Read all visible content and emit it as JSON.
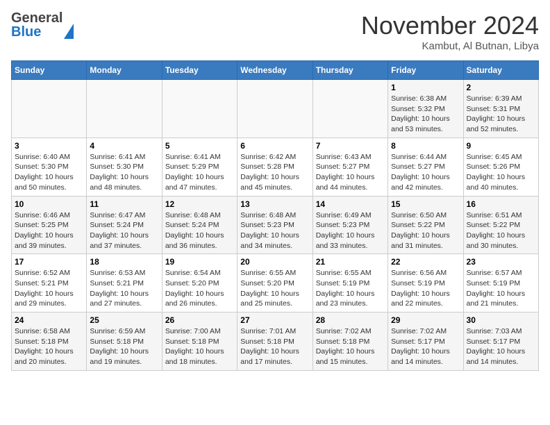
{
  "header": {
    "logo_general": "General",
    "logo_blue": "Blue",
    "month_title": "November 2024",
    "subtitle": "Kambut, Al Butnan, Libya"
  },
  "weekdays": [
    "Sunday",
    "Monday",
    "Tuesday",
    "Wednesday",
    "Thursday",
    "Friday",
    "Saturday"
  ],
  "weeks": [
    [
      {
        "day": "",
        "info": ""
      },
      {
        "day": "",
        "info": ""
      },
      {
        "day": "",
        "info": ""
      },
      {
        "day": "",
        "info": ""
      },
      {
        "day": "",
        "info": ""
      },
      {
        "day": "1",
        "info": "Sunrise: 6:38 AM\nSunset: 5:32 PM\nDaylight: 10 hours\nand 53 minutes."
      },
      {
        "day": "2",
        "info": "Sunrise: 6:39 AM\nSunset: 5:31 PM\nDaylight: 10 hours\nand 52 minutes."
      }
    ],
    [
      {
        "day": "3",
        "info": "Sunrise: 6:40 AM\nSunset: 5:30 PM\nDaylight: 10 hours\nand 50 minutes."
      },
      {
        "day": "4",
        "info": "Sunrise: 6:41 AM\nSunset: 5:30 PM\nDaylight: 10 hours\nand 48 minutes."
      },
      {
        "day": "5",
        "info": "Sunrise: 6:41 AM\nSunset: 5:29 PM\nDaylight: 10 hours\nand 47 minutes."
      },
      {
        "day": "6",
        "info": "Sunrise: 6:42 AM\nSunset: 5:28 PM\nDaylight: 10 hours\nand 45 minutes."
      },
      {
        "day": "7",
        "info": "Sunrise: 6:43 AM\nSunset: 5:27 PM\nDaylight: 10 hours\nand 44 minutes."
      },
      {
        "day": "8",
        "info": "Sunrise: 6:44 AM\nSunset: 5:27 PM\nDaylight: 10 hours\nand 42 minutes."
      },
      {
        "day": "9",
        "info": "Sunrise: 6:45 AM\nSunset: 5:26 PM\nDaylight: 10 hours\nand 40 minutes."
      }
    ],
    [
      {
        "day": "10",
        "info": "Sunrise: 6:46 AM\nSunset: 5:25 PM\nDaylight: 10 hours\nand 39 minutes."
      },
      {
        "day": "11",
        "info": "Sunrise: 6:47 AM\nSunset: 5:24 PM\nDaylight: 10 hours\nand 37 minutes."
      },
      {
        "day": "12",
        "info": "Sunrise: 6:48 AM\nSunset: 5:24 PM\nDaylight: 10 hours\nand 36 minutes."
      },
      {
        "day": "13",
        "info": "Sunrise: 6:48 AM\nSunset: 5:23 PM\nDaylight: 10 hours\nand 34 minutes."
      },
      {
        "day": "14",
        "info": "Sunrise: 6:49 AM\nSunset: 5:23 PM\nDaylight: 10 hours\nand 33 minutes."
      },
      {
        "day": "15",
        "info": "Sunrise: 6:50 AM\nSunset: 5:22 PM\nDaylight: 10 hours\nand 31 minutes."
      },
      {
        "day": "16",
        "info": "Sunrise: 6:51 AM\nSunset: 5:22 PM\nDaylight: 10 hours\nand 30 minutes."
      }
    ],
    [
      {
        "day": "17",
        "info": "Sunrise: 6:52 AM\nSunset: 5:21 PM\nDaylight: 10 hours\nand 29 minutes."
      },
      {
        "day": "18",
        "info": "Sunrise: 6:53 AM\nSunset: 5:21 PM\nDaylight: 10 hours\nand 27 minutes."
      },
      {
        "day": "19",
        "info": "Sunrise: 6:54 AM\nSunset: 5:20 PM\nDaylight: 10 hours\nand 26 minutes."
      },
      {
        "day": "20",
        "info": "Sunrise: 6:55 AM\nSunset: 5:20 PM\nDaylight: 10 hours\nand 25 minutes."
      },
      {
        "day": "21",
        "info": "Sunrise: 6:55 AM\nSunset: 5:19 PM\nDaylight: 10 hours\nand 23 minutes."
      },
      {
        "day": "22",
        "info": "Sunrise: 6:56 AM\nSunset: 5:19 PM\nDaylight: 10 hours\nand 22 minutes."
      },
      {
        "day": "23",
        "info": "Sunrise: 6:57 AM\nSunset: 5:19 PM\nDaylight: 10 hours\nand 21 minutes."
      }
    ],
    [
      {
        "day": "24",
        "info": "Sunrise: 6:58 AM\nSunset: 5:18 PM\nDaylight: 10 hours\nand 20 minutes."
      },
      {
        "day": "25",
        "info": "Sunrise: 6:59 AM\nSunset: 5:18 PM\nDaylight: 10 hours\nand 19 minutes."
      },
      {
        "day": "26",
        "info": "Sunrise: 7:00 AM\nSunset: 5:18 PM\nDaylight: 10 hours\nand 18 minutes."
      },
      {
        "day": "27",
        "info": "Sunrise: 7:01 AM\nSunset: 5:18 PM\nDaylight: 10 hours\nand 17 minutes."
      },
      {
        "day": "28",
        "info": "Sunrise: 7:02 AM\nSunset: 5:18 PM\nDaylight: 10 hours\nand 15 minutes."
      },
      {
        "day": "29",
        "info": "Sunrise: 7:02 AM\nSunset: 5:17 PM\nDaylight: 10 hours\nand 14 minutes."
      },
      {
        "day": "30",
        "info": "Sunrise: 7:03 AM\nSunset: 5:17 PM\nDaylight: 10 hours\nand 14 minutes."
      }
    ]
  ]
}
